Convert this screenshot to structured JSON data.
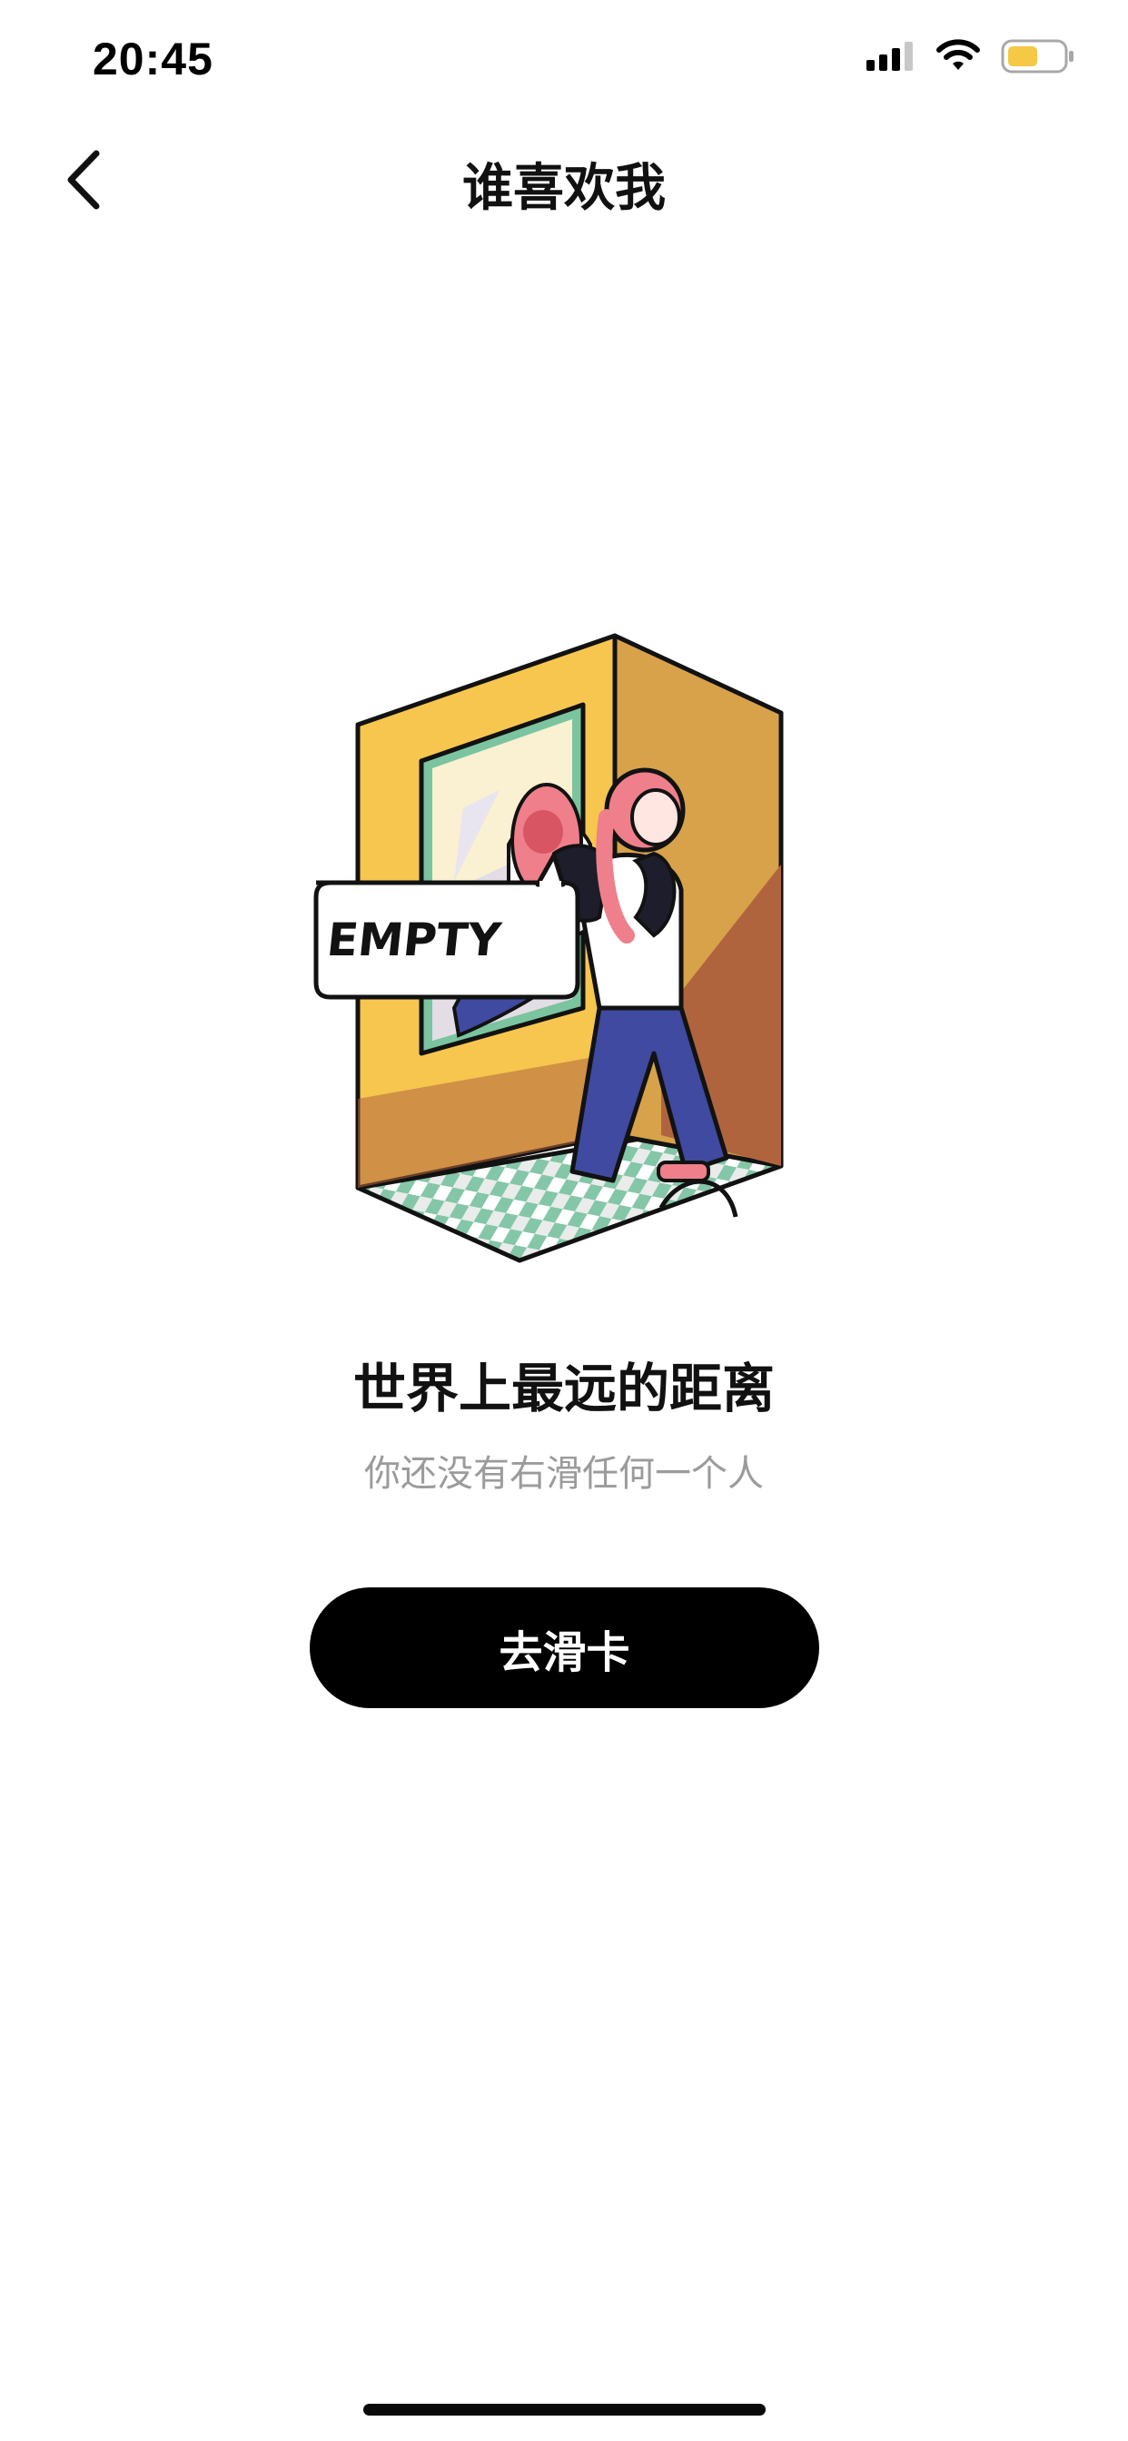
{
  "status_bar": {
    "time": "20:45",
    "icons": [
      "cellular-signal-icon",
      "wifi-icon",
      "battery-icon"
    ],
    "battery_color": "#F5C845"
  },
  "nav": {
    "title": "谁喜欢我",
    "back_icon": "chevron-left-icon"
  },
  "illustration": {
    "badge_text": "EMPTY",
    "colors": {
      "wall_left": "#F6C64F",
      "wall_right": "#D7A24A",
      "floor_shadow": "#B0643E",
      "mirror_frame": "#7BC4A0",
      "tile": "#84C6A8",
      "hair": "#EE7F8B",
      "pants": "#3F4AA0",
      "outline": "#121212"
    }
  },
  "empty_state": {
    "title": "世界上最远的距离",
    "subtitle": "你还没有右滑任何一个人"
  },
  "cta": {
    "label": "去滑卡"
  },
  "theme": {
    "background": "#FFFFFF",
    "primary": "#000000",
    "on_primary": "#FFFFFF",
    "secondary_text": "#9B9B9B"
  }
}
